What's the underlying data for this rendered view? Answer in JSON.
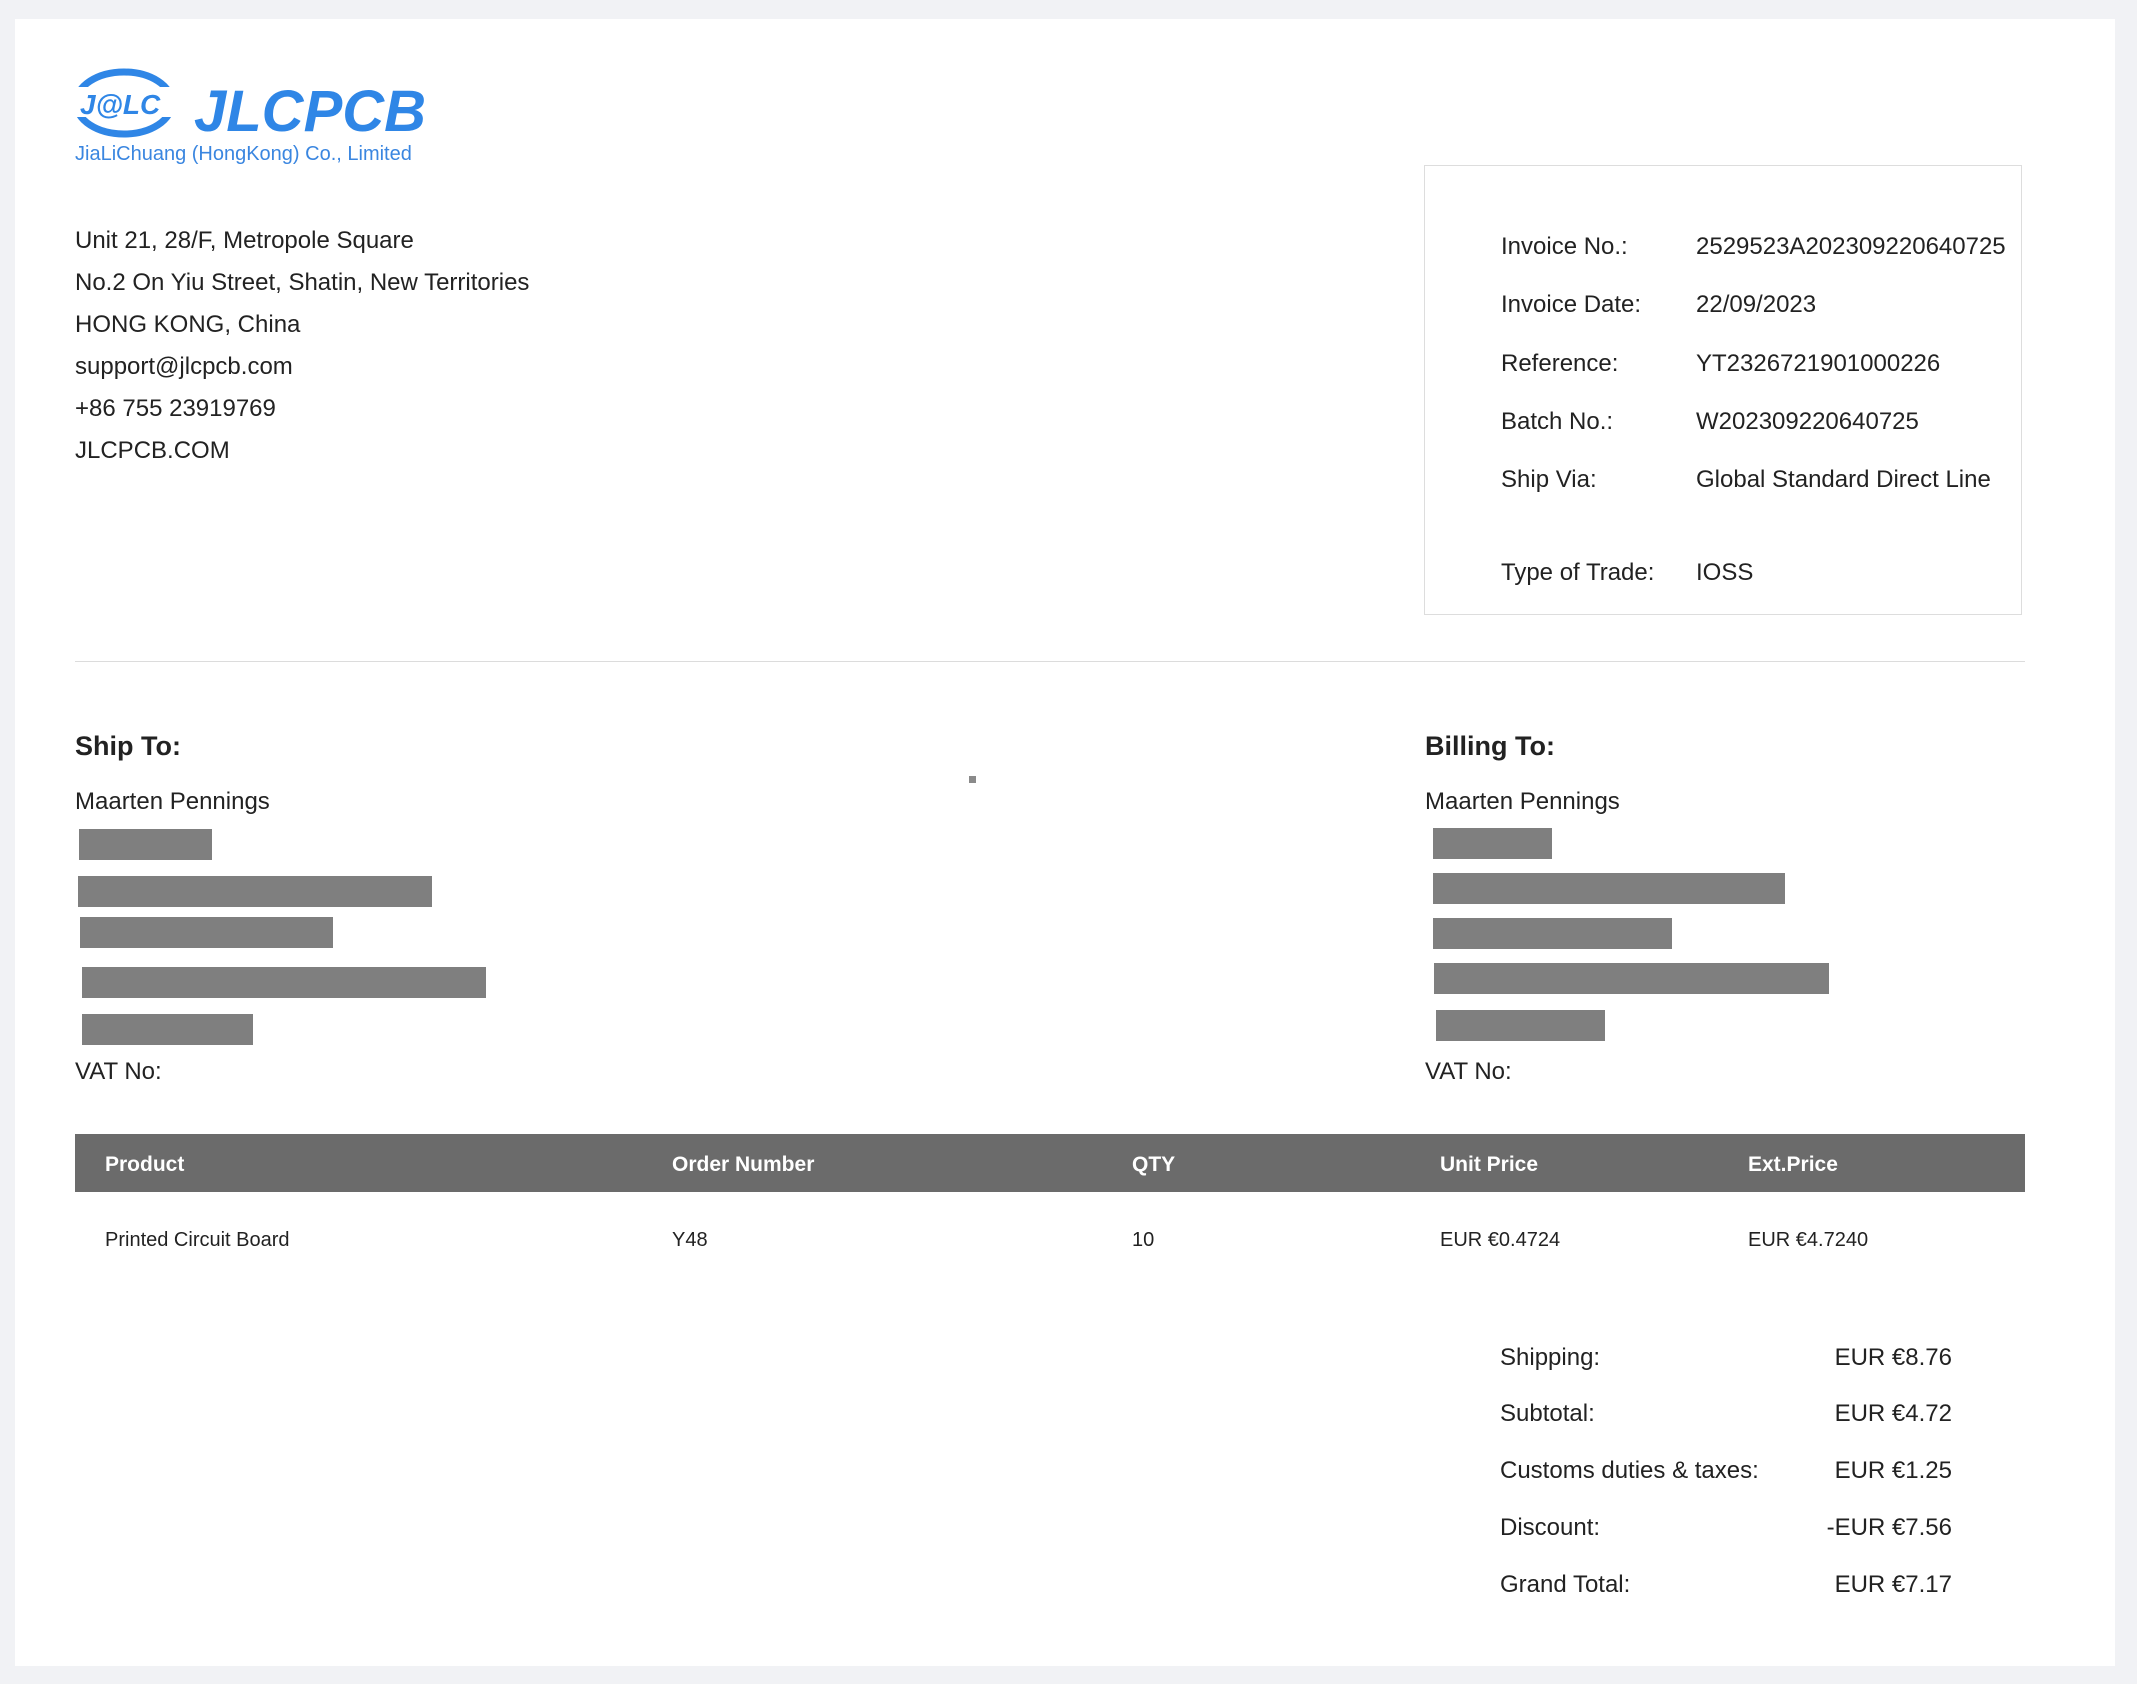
{
  "company": {
    "logo_mark": "J@LC",
    "logo_text": "JLCPCB",
    "name": "JiaLiChuang (HongKong) Co., Limited",
    "address_lines": [
      "Unit 21, 28/F, Metropole Square",
      "No.2 On Yiu Street, Shatin, New Territories",
      "HONG KONG, China",
      "support@jlcpcb.com",
      "+86 755 23919769",
      "JLCPCB.COM"
    ],
    "brand_color": "#2f86e6"
  },
  "invoice": {
    "rows": [
      {
        "label": "Invoice No.:",
        "value": "2529523A202309220640725"
      },
      {
        "label": "Invoice Date:",
        "value": "22/09/2023"
      },
      {
        "label": "Reference:",
        "value": "YT2326721901000226"
      },
      {
        "label": "Batch No.:",
        "value": "W202309220640725"
      },
      {
        "label": "Ship Via:",
        "value": "Global Standard Direct Line"
      },
      {
        "label": "Type of Trade:",
        "value": "IOSS"
      }
    ]
  },
  "ship_to": {
    "title": "Ship To:",
    "name": "Maarten Pennings",
    "vat_label": "VAT No:"
  },
  "billing_to": {
    "title": "Billing To:",
    "name": "Maarten Pennings",
    "vat_label": "VAT No:"
  },
  "table": {
    "headers": [
      "Product",
      "Order Number",
      "QTY",
      "Unit Price",
      "Ext.Price"
    ],
    "rows": [
      [
        "Printed Circuit Board",
        "Y48",
        "10",
        "EUR €0.4724",
        "EUR €4.7240"
      ]
    ],
    "header_bg": "#6b6b6b"
  },
  "totals": [
    {
      "label": "Shipping:",
      "value": "EUR €8.76"
    },
    {
      "label": "Subtotal:",
      "value": "EUR €4.72"
    },
    {
      "label": "Customs duties & taxes:",
      "value": "EUR €1.25"
    },
    {
      "label": "Discount:",
      "value": "-EUR €7.56"
    },
    {
      "label": "Grand Total:",
      "value": "EUR €7.17"
    }
  ]
}
